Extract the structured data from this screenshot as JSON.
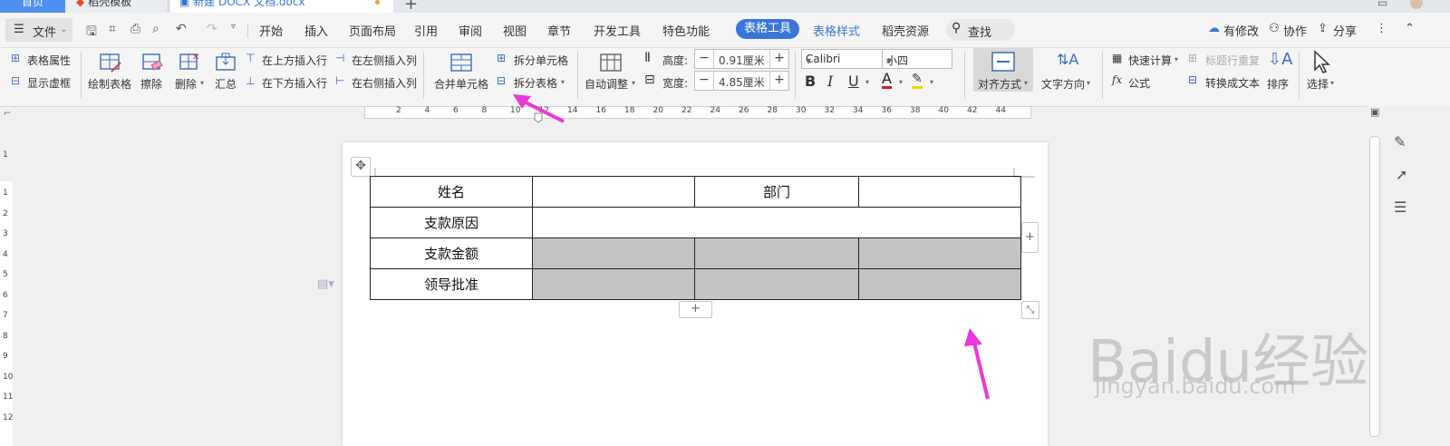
{
  "titlebar": {
    "tabs": [
      "首页",
      "稻壳模板",
      "新建 DOCX 文档.docx"
    ],
    "add_symbol": "+"
  },
  "menubar": {
    "file_label": "文件",
    "tabs": [
      "开始",
      "插入",
      "页面布局",
      "引用",
      "审阅",
      "视图",
      "章节",
      "开发工具",
      "特色功能",
      "表格工具",
      "表格样式",
      "稻壳资源"
    ],
    "search_label": "查找",
    "right": [
      "有修改",
      "协作",
      "分享"
    ]
  },
  "ribbon": {
    "table_props": "表格属性",
    "show_grid": "显示虚框",
    "draw_table": "绘制表格",
    "erase": "擦除",
    "delete": "删除",
    "summary": "汇总",
    "insert_above": "在上方插入行",
    "insert_below": "在下方插入行",
    "insert_left": "在左侧插入列",
    "insert_right": "在右侧插入列",
    "merge_cells": "合并单元格",
    "split_cells": "拆分单元格",
    "split_table": "拆分表格",
    "auto_fit": "自动调整",
    "height_label": "高度:",
    "height_value": "0.91厘米",
    "width_label": "宽度:",
    "width_value": "4.85厘米",
    "font_name": "Calibri",
    "font_size": "小四",
    "align": "对齐方式",
    "text_direction": "文字方向",
    "quick_calc": "快速计算",
    "repeat_header": "标题行重复",
    "formula": "公式",
    "to_text": "转换成文本",
    "sort": "排序",
    "select": "选择"
  },
  "ruler": {
    "h_ticks": [
      "2",
      "4",
      "6",
      "8",
      "10",
      "12",
      "14",
      "16",
      "18",
      "20",
      "22",
      "24",
      "26",
      "28",
      "30",
      "32",
      "34",
      "36",
      "38",
      "40",
      "42",
      "44"
    ],
    "v_ticks": [
      "1",
      "2",
      "3",
      "4",
      "5",
      "6",
      "7",
      "8",
      "9",
      "10",
      "11",
      "12"
    ]
  },
  "table": {
    "rows": [
      [
        "姓名",
        "",
        "部门",
        ""
      ],
      [
        "支款原因",
        ""
      ],
      [
        "支款金额",
        "",
        "",
        ""
      ],
      [
        "领导批准",
        "",
        "",
        ""
      ]
    ]
  },
  "watermark": {
    "main": "Baidu经验",
    "sub": "jingyan.baidu.com"
  },
  "colors": {
    "accent": "#3a76d8",
    "arrow": "#e83ad8",
    "shaded_cell": "#c4c4c4"
  }
}
